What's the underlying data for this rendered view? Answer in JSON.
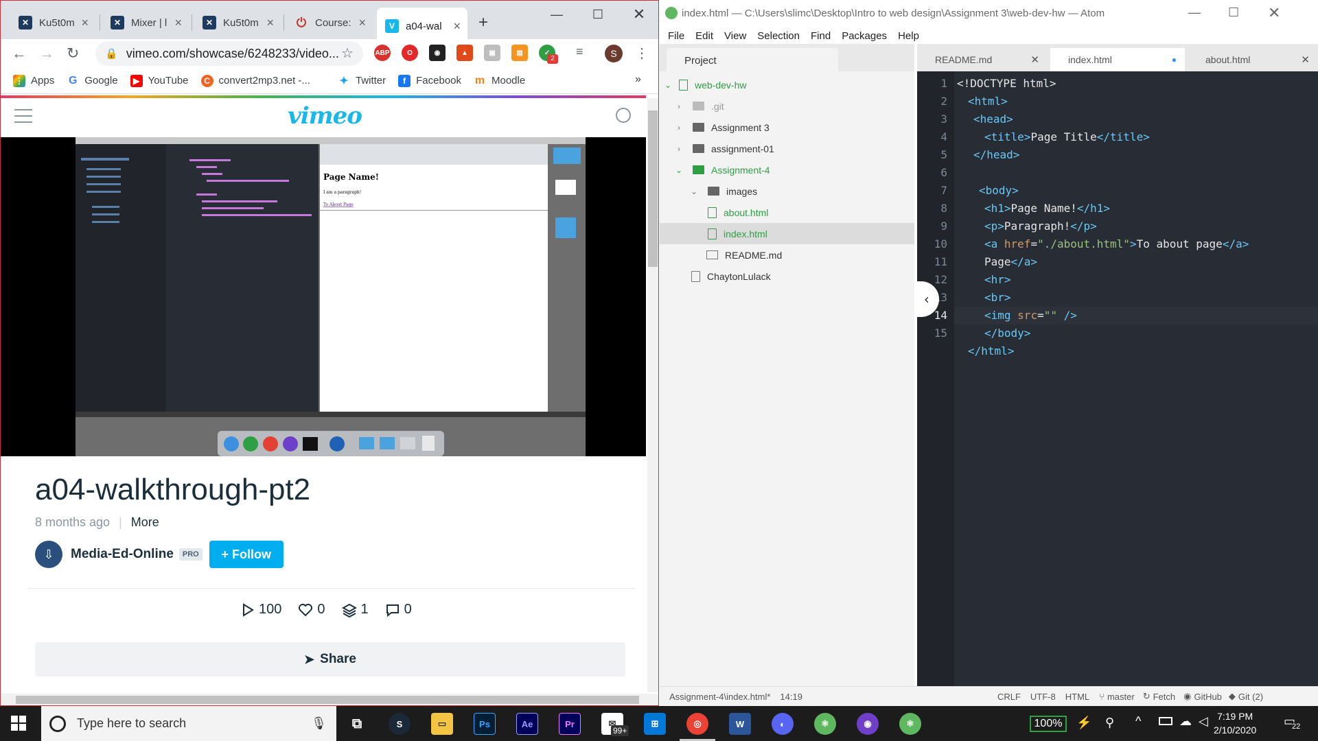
{
  "chrome": {
    "tabs": [
      {
        "title": "Ku5t0m"
      },
      {
        "title": "Mixer | l"
      },
      {
        "title": "Ku5t0m"
      },
      {
        "title": "Course:"
      },
      {
        "title": "a04-wal"
      }
    ],
    "url": "vimeo.com/showcase/6248233/video...",
    "profile_initial": "S",
    "ext_badge": "2",
    "bookmarks": [
      {
        "label": "Apps"
      },
      {
        "label": "Google"
      },
      {
        "label": "YouTube"
      },
      {
        "label": "convert2mp3.net -..."
      },
      {
        "label": "Twitter"
      },
      {
        "label": "Facebook"
      },
      {
        "label": "Moodle"
      }
    ],
    "more_bookmarks": "»"
  },
  "vimeo": {
    "logo": "vimeo",
    "video_title": "a04-walkthrough-pt2",
    "posted": "8 months ago",
    "more": "More",
    "channel": "Media-Ed-Online",
    "pro": "PRO",
    "follow": "+ Follow",
    "stats": {
      "plays": "100",
      "likes": "0",
      "collections": "1",
      "comments": "0"
    },
    "share": "Share"
  },
  "atom": {
    "title": "index.html — C:\\Users\\slimc\\Desktop\\Intro to web design\\Assignment 3\\web-dev-hw — Atom",
    "menu": [
      "File",
      "Edit",
      "View",
      "Selection",
      "Find",
      "Packages",
      "Help"
    ],
    "project_tab": "Project",
    "tree": [
      {
        "label": "web-dev-hw"
      },
      {
        "label": ".git"
      },
      {
        "label": "Assignment 3"
      },
      {
        "label": "assignment-01"
      },
      {
        "label": "Assignment-4"
      },
      {
        "label": "images"
      },
      {
        "label": "about.html"
      },
      {
        "label": "index.html"
      },
      {
        "label": "README.md"
      },
      {
        "label": "ChaytonLulack"
      }
    ],
    "editor_tabs": [
      "README.md",
      "index.html",
      "about.html"
    ],
    "status": {
      "path": "Assignment-4\\index.html*",
      "cursor": "14:19",
      "crlf": "CRLF",
      "encoding": "UTF-8",
      "grammar": "HTML",
      "branch": "master",
      "fetch": "Fetch",
      "github": "GitHub",
      "git": "Git (2)"
    }
  },
  "code_lines": [
    {
      "n": "1"
    },
    {
      "n": "2"
    },
    {
      "n": "3"
    },
    {
      "n": "4"
    },
    {
      "n": "5"
    },
    {
      "n": "6"
    },
    {
      "n": "7"
    },
    {
      "n": "8"
    },
    {
      "n": "9"
    },
    {
      "n": "10"
    },
    {
      "n": "11"
    },
    {
      "n": "12"
    },
    {
      "n": "13"
    },
    {
      "n": "14"
    },
    {
      "n": "15"
    }
  ],
  "code": {
    "l1": "<!DOCTYPE html>",
    "l2_tag": "<html>",
    "l3_tag": "<head>",
    "l4_open": "<title>",
    "l4_text": "Page Title",
    "l4_close": "</title>",
    "l5_tag": "</head>",
    "l7_tag": "<body>",
    "l8_open": "<h1>",
    "l8_text": "Page Name!",
    "l8_close": "</h1>",
    "l9_open": "<p>",
    "l9_text": "Paragraph!",
    "l9_close": "</p>",
    "l10_open": "<a ",
    "l10_attr": "href",
    "l10_eq": "=",
    "l10_val": "\"./about.html\"",
    "l10_gt": ">",
    "l10_text": "To about page",
    "l10_close": "</a>",
    "l11_text": "Page",
    "l11_close": "</a>",
    "l12_tag": "<hr>",
    "l13_tag": "<br>",
    "l14_open": "<img",
    "l14_attr": "src",
    "l14_eq": "=",
    "l14_val": "\"\"",
    "l14_end": " />",
    "l15_tag": "</body>",
    "l16_tag": "</html>"
  },
  "taskbar": {
    "search_placeholder": "Type here to search",
    "badge": "99+",
    "battery": "100%",
    "time": "7:19 PM",
    "date": "2/10/2020",
    "notif_count": "22"
  }
}
